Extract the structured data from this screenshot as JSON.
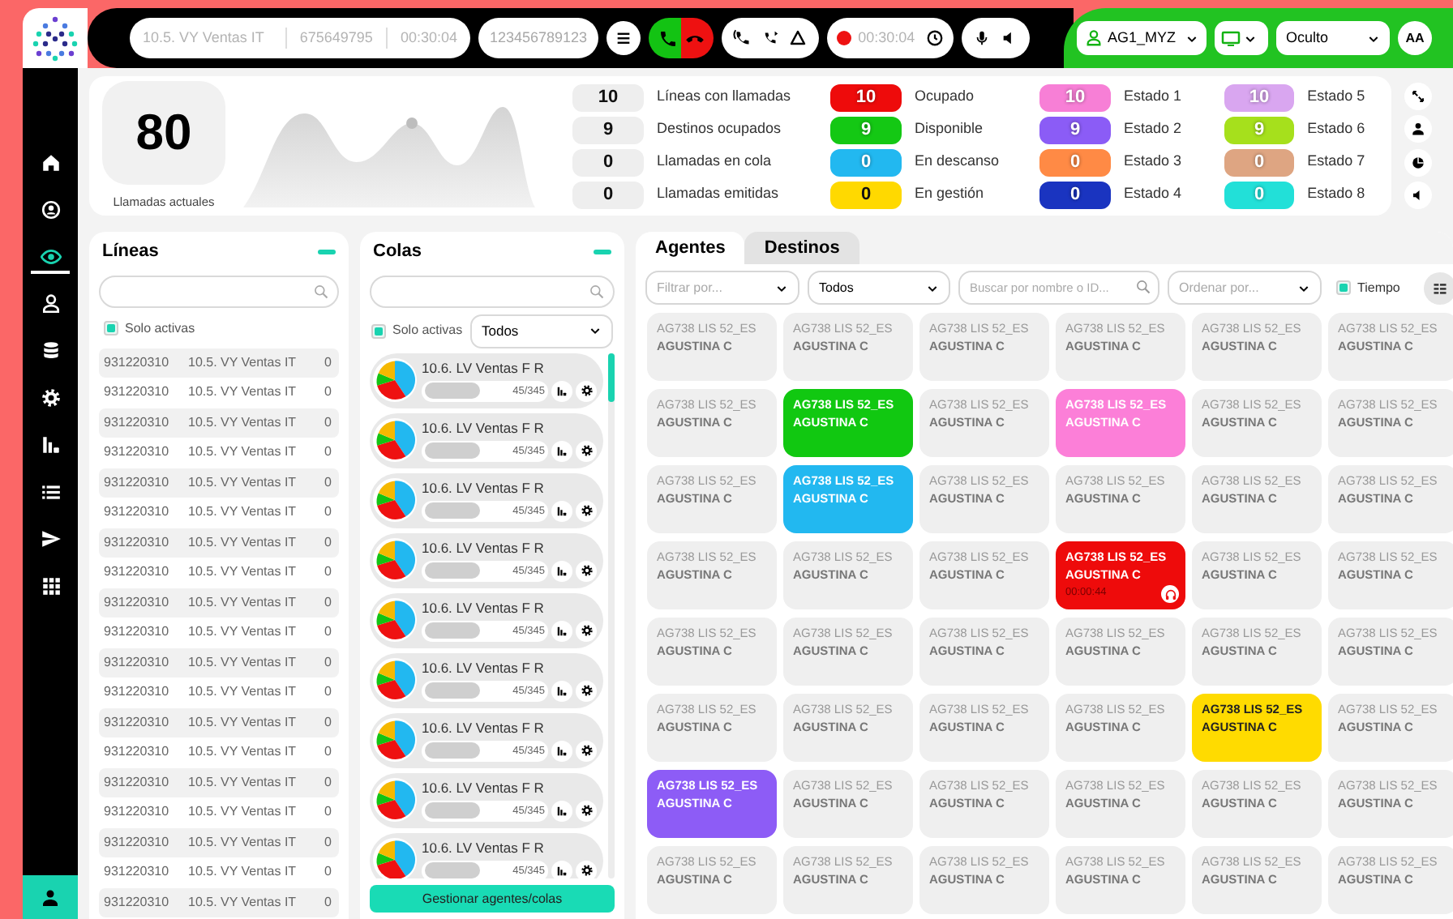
{
  "topbar": {
    "call_info": [
      "10.5. VY Ventas IT",
      "675649795",
      "00:30:04"
    ],
    "number": "123456789123",
    "record_time": "00:30:04",
    "user": "AG1_MYZ",
    "visibility": "Oculto",
    "avatar": "AA"
  },
  "sidebar": {
    "items": [
      {
        "kind": "home",
        "selected": false
      },
      {
        "kind": "badge",
        "selected": false
      },
      {
        "kind": "eye",
        "selected": true
      },
      {
        "kind": "user",
        "selected": false
      },
      {
        "kind": "database",
        "selected": false
      },
      {
        "kind": "gear",
        "selected": false
      },
      {
        "kind": "bars",
        "selected": false
      },
      {
        "kind": "list",
        "selected": false
      },
      {
        "kind": "send",
        "selected": false
      },
      {
        "kind": "grid",
        "selected": false
      }
    ]
  },
  "summary": {
    "current_calls": "80",
    "current_calls_label": "Llamadas actuales"
  },
  "stats": [
    [
      {
        "count": "10",
        "label": "Líneas con llamadas",
        "color": "#eeeeee"
      },
      {
        "count": "9",
        "label": "Destinos ocupados",
        "color": "#eeeeee"
      },
      {
        "count": "0",
        "label": "Llamadas en cola",
        "color": "#eeeeee"
      },
      {
        "count": "0",
        "label": "Llamadas emitidas",
        "color": "#eeeeee"
      }
    ],
    [
      {
        "count": "10",
        "label": "Ocupado",
        "color": "#ee0b0b"
      },
      {
        "count": "9",
        "label": "Disponible",
        "color": "#14c814"
      },
      {
        "count": "0",
        "label": "En descanso",
        "color": "#22b8f0"
      },
      {
        "count": "0",
        "label": "En gestión",
        "color": "#ffd900"
      }
    ],
    [
      {
        "count": "10",
        "label": "Estado 1",
        "color": "#f77fd6"
      },
      {
        "count": "9",
        "label": "Estado 2",
        "color": "#8b5cf6"
      },
      {
        "count": "0",
        "label": "Estado 3",
        "color": "#ff8a45"
      },
      {
        "count": "0",
        "label": "Estado 4",
        "color": "#1a34c0"
      }
    ],
    [
      {
        "count": "10",
        "label": "Estado 5",
        "color": "#d9a6f0"
      },
      {
        "count": "9",
        "label": "Estado 6",
        "color": "#a6e01c"
      },
      {
        "count": "0",
        "label": "Estado 7",
        "color": "#dea582"
      },
      {
        "count": "0",
        "label": "Estado 8",
        "color": "#22e0d8"
      }
    ]
  ],
  "lines": {
    "title": "Líneas",
    "only_active": {
      "label": "Solo activas",
      "checked": true
    },
    "rows": [
      {
        "number": "931220310",
        "name": "10.5. VY Ventas IT",
        "count": "0"
      },
      {
        "number": "931220310",
        "name": "10.5. VY Ventas IT",
        "count": "0"
      },
      {
        "number": "931220310",
        "name": "10.5. VY Ventas IT",
        "count": "0"
      },
      {
        "number": "931220310",
        "name": "10.5. VY Ventas IT",
        "count": "0"
      },
      {
        "number": "931220310",
        "name": "10.5. VY Ventas IT",
        "count": "0"
      },
      {
        "number": "931220310",
        "name": "10.5. VY Ventas IT",
        "count": "0"
      },
      {
        "number": "931220310",
        "name": "10.5. VY Ventas IT",
        "count": "0"
      },
      {
        "number": "931220310",
        "name": "10.5. VY Ventas IT",
        "count": "0"
      },
      {
        "number": "931220310",
        "name": "10.5. VY Ventas IT",
        "count": "0"
      },
      {
        "number": "931220310",
        "name": "10.5. VY Ventas IT",
        "count": "0"
      },
      {
        "number": "931220310",
        "name": "10.5. VY Ventas IT",
        "count": "0"
      },
      {
        "number": "931220310",
        "name": "10.5. VY Ventas IT",
        "count": "0"
      },
      {
        "number": "931220310",
        "name": "10.5. VY Ventas IT",
        "count": "0"
      },
      {
        "number": "931220310",
        "name": "10.5. VY Ventas IT",
        "count": "0"
      },
      {
        "number": "931220310",
        "name": "10.5. VY Ventas IT",
        "count": "0"
      },
      {
        "number": "931220310",
        "name": "10.5. VY Ventas IT",
        "count": "0"
      },
      {
        "number": "931220310",
        "name": "10.5. VY Ventas IT",
        "count": "0"
      },
      {
        "number": "931220310",
        "name": "10.5. VY Ventas IT",
        "count": "0"
      },
      {
        "number": "931220310",
        "name": "10.5. VY Ventas IT",
        "count": "0"
      }
    ]
  },
  "queues": {
    "title": "Colas",
    "only_active": {
      "label": "Solo activas",
      "checked": true
    },
    "filter": "Todos",
    "items": [
      {
        "name": "10.6. LV Ventas F R",
        "count": "45/345"
      },
      {
        "name": "10.6. LV Ventas F R",
        "count": "45/345"
      },
      {
        "name": "10.6. LV Ventas F R",
        "count": "45/345"
      },
      {
        "name": "10.6. LV Ventas F R",
        "count": "45/345"
      },
      {
        "name": "10.6. LV Ventas F R",
        "count": "45/345"
      },
      {
        "name": "10.6. LV Ventas F R",
        "count": "45/345"
      },
      {
        "name": "10.6. LV Ventas F R",
        "count": "45/345"
      },
      {
        "name": "10.6. LV Ventas F R",
        "count": "45/345"
      },
      {
        "name": "10.6. LV Ventas F R",
        "count": "45/345"
      }
    ],
    "button": "Gestionar agentes/colas"
  },
  "agents": {
    "tabs": [
      {
        "label": "Agentes",
        "selected": true
      },
      {
        "label": "Destinos",
        "selected": false
      }
    ],
    "filter_placeholder": "Filtrar por...",
    "group": "Todos",
    "search_placeholder": "Buscar por nombre o ID...",
    "sort_placeholder": "Ordenar por...",
    "time": {
      "label": "Tiempo",
      "checked": true
    },
    "tiles": [
      [
        {
          "kind": "agent",
          "id": "AG738 LIS 52_ES",
          "name": "AGUSTINA C",
          "color": "#efefef"
        },
        {
          "kind": "agent",
          "id": "AG738 LIS 52_ES",
          "name": "AGUSTINA C",
          "color": "#efefef"
        },
        {
          "kind": "agent",
          "id": "AG738 LIS 52_ES",
          "name": "AGUSTINA C",
          "color": "#efefef"
        },
        {
          "kind": "agent",
          "id": "AG738 LIS 52_ES",
          "name": "AGUSTINA C",
          "color": "#efefef"
        },
        {
          "kind": "agent",
          "id": "AG738 LIS 52_ES",
          "name": "AGUSTINA C",
          "color": "#efefef"
        },
        {
          "kind": "agent",
          "id": "AG738 LIS 52_ES",
          "name": "AGUSTINA C",
          "color": "#efefef"
        }
      ],
      [
        {
          "kind": "agent",
          "id": "AG738 LIS 52_ES",
          "name": "AGUSTINA C",
          "color": "#efefef"
        },
        {
          "kind": "agent",
          "id": "AG738 LIS 52_ES",
          "name": "AGUSTINA C",
          "color": "#11c811"
        },
        {
          "kind": "agent",
          "id": "AG738 LIS 52_ES",
          "name": "AGUSTINA C",
          "color": "#efefef"
        },
        {
          "kind": "agent",
          "id": "AG738 LIS 52_ES",
          "name": "AGUSTINA C",
          "color": "#fc7fd8"
        },
        {
          "kind": "agent",
          "id": "AG738 LIS 52_ES",
          "name": "AGUSTINA C",
          "color": "#efefef"
        },
        {
          "kind": "agent",
          "id": "AG738 LIS 52_ES",
          "name": "AGUSTINA C",
          "color": "#efefef"
        }
      ],
      [
        {
          "kind": "agent",
          "id": "AG738 LIS 52_ES",
          "name": "AGUSTINA C",
          "color": "#efefef"
        },
        {
          "kind": "agent",
          "id": "AG738 LIS 52_ES",
          "name": "AGUSTINA C",
          "color": "#22b8f0"
        },
        {
          "kind": "agent",
          "id": "AG738 LIS 52_ES",
          "name": "AGUSTINA C",
          "color": "#efefef"
        },
        {
          "kind": "agent",
          "id": "AG738 LIS 52_ES",
          "name": "AGUSTINA C",
          "color": "#efefef"
        },
        {
          "kind": "agent",
          "id": "AG738 LIS 52_ES",
          "name": "AGUSTINA C",
          "color": "#efefef"
        },
        {
          "kind": "agent",
          "id": "AG738 LIS 52_ES",
          "name": "AGUSTINA C",
          "color": "#efefef"
        }
      ],
      [
        {
          "kind": "agent",
          "id": "AG738 LIS 52_ES",
          "name": "AGUSTINA C",
          "color": "#efefef"
        },
        {
          "kind": "agent",
          "id": "AG738 LIS 52_ES",
          "name": "AGUSTINA C",
          "color": "#efefef"
        },
        {
          "kind": "agent",
          "id": "AG738 LIS 52_ES",
          "name": "AGUSTINA C",
          "color": "#efefef"
        },
        {
          "kind": "call",
          "id": "AG738 LIS 52_ES",
          "name": "AGUSTINA C",
          "color": "#ee0b0b",
          "time": "00:00:44"
        },
        {
          "kind": "agent",
          "id": "AG738 LIS 52_ES",
          "name": "AGUSTINA C",
          "color": "#efefef"
        },
        {
          "kind": "agent",
          "id": "AG738 LIS 52_ES",
          "name": "AGUSTINA C",
          "color": "#efefef"
        }
      ],
      [
        {
          "kind": "agent",
          "id": "AG738 LIS 52_ES",
          "name": "AGUSTINA C",
          "color": "#efefef"
        },
        {
          "kind": "agent",
          "id": "AG738 LIS 52_ES",
          "name": "AGUSTINA C",
          "color": "#efefef"
        },
        {
          "kind": "agent",
          "id": "AG738 LIS 52_ES",
          "name": "AGUSTINA C",
          "color": "#efefef"
        },
        {
          "kind": "agent",
          "id": "AG738 LIS 52_ES",
          "name": "AGUSTINA C",
          "color": "#efefef"
        },
        {
          "kind": "agent",
          "id": "AG738 LIS 52_ES",
          "name": "AGUSTINA C",
          "color": "#efefef"
        },
        {
          "kind": "agent",
          "id": "AG738 LIS 52_ES",
          "name": "AGUSTINA C",
          "color": "#efefef"
        }
      ],
      [
        {
          "kind": "agent",
          "id": "AG738 LIS 52_ES",
          "name": "AGUSTINA C",
          "color": "#efefef"
        },
        {
          "kind": "agent",
          "id": "AG738 LIS 52_ES",
          "name": "AGUSTINA C",
          "color": "#efefef"
        },
        {
          "kind": "agent",
          "id": "AG738 LIS 52_ES",
          "name": "AGUSTINA C",
          "color": "#efefef"
        },
        {
          "kind": "agent",
          "id": "AG738 LIS 52_ES",
          "name": "AGUSTINA C",
          "color": "#efefef"
        },
        {
          "kind": "agent",
          "id": "AG738 LIS 52_ES",
          "name": "AGUSTINA C",
          "color": "#ffdb00"
        },
        {
          "kind": "agent",
          "id": "AG738 LIS 52_ES",
          "name": "AGUSTINA C",
          "color": "#efefef"
        }
      ],
      [
        {
          "kind": "agent",
          "id": "AG738 LIS 52_ES",
          "name": "AGUSTINA C",
          "color": "#8d5cf6"
        },
        {
          "kind": "agent",
          "id": "AG738 LIS 52_ES",
          "name": "AGUSTINA C",
          "color": "#efefef"
        },
        {
          "kind": "agent",
          "id": "AG738 LIS 52_ES",
          "name": "AGUSTINA C",
          "color": "#efefef"
        },
        {
          "kind": "agent",
          "id": "AG738 LIS 52_ES",
          "name": "AGUSTINA C",
          "color": "#efefef"
        },
        {
          "kind": "agent",
          "id": "AG738 LIS 52_ES",
          "name": "AGUSTINA C",
          "color": "#efefef"
        },
        {
          "kind": "agent",
          "id": "AG738 LIS 52_ES",
          "name": "AGUSTINA C",
          "color": "#efefef"
        }
      ],
      [
        {
          "kind": "agent",
          "id": "AG738 LIS 52_ES",
          "name": "AGUSTINA C",
          "color": "#efefef"
        },
        {
          "kind": "agent",
          "id": "AG738 LIS 52_ES",
          "name": "AGUSTINA C",
          "color": "#efefef"
        },
        {
          "kind": "agent",
          "id": "AG738 LIS 52_ES",
          "name": "AGUSTINA C",
          "color": "#efefef"
        },
        {
          "kind": "agent",
          "id": "AG738 LIS 52_ES",
          "name": "AGUSTINA C",
          "color": "#efefef"
        },
        {
          "kind": "agent",
          "id": "AG738 LIS 52_ES",
          "name": "AGUSTINA C",
          "color": "#efefef"
        },
        {
          "kind": "agent",
          "id": "AG738 LIS 52_ES",
          "name": "AGUSTINA C",
          "color": "#efefef"
        }
      ]
    ]
  }
}
